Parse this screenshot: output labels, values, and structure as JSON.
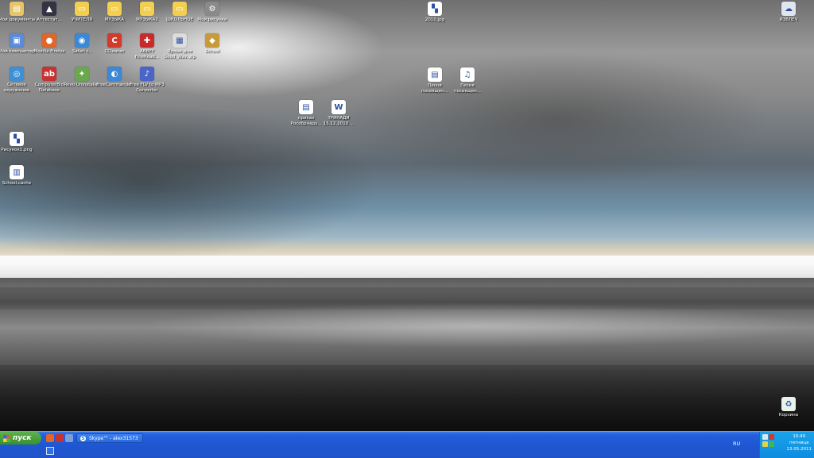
{
  "desktop": {
    "icons": [
      {
        "label": "Мои документы",
        "icon": "documents-folder-icon",
        "color": "#e6c56a",
        "sym": "▤"
      },
      {
        "label": "Аттестат...",
        "icon": "graduation-cap-icon",
        "color": "#333344",
        "sym": "▲"
      },
      {
        "label": "УЧИТЕЛЯ",
        "icon": "folder-icon",
        "color": "#f2cf52",
        "sym": "▭"
      },
      {
        "label": "МУЗЫКА",
        "icon": "folder-icon",
        "color": "#f2cf52",
        "sym": "▭"
      },
      {
        "label": "МУЗЫКА2",
        "icon": "folder-icon",
        "color": "#f2cf52",
        "sym": "▭"
      },
      {
        "label": "ШКОЛЬНОЕ",
        "icon": "folder-icon",
        "color": "#f2cf52",
        "sym": "▭"
      },
      {
        "label": "Мои рисунки",
        "icon": "settings-icon",
        "color": "#8a8a8a",
        "sym": "⚙"
      },
      {
        "label": "Мой компьютер",
        "icon": "computer-icon",
        "color": "#5b8bd9",
        "sym": "▣"
      },
      {
        "label": "Mozilla Firefox",
        "icon": "firefox-icon",
        "color": "#e0662a",
        "sym": "●"
      },
      {
        "label": "Safari с..",
        "icon": "safari-icon",
        "color": "#3b89d6",
        "sym": "◉"
      },
      {
        "label": "CCleaner",
        "icon": "ccleaner-icon",
        "color": "#d23a2a",
        "sym": "C"
      },
      {
        "label": "ABBYY FineRead...",
        "icon": "abbyy-icon",
        "color": "#c92b2b",
        "sym": "✚"
      },
      {
        "label": "Ярлык для Good_Wav..zip",
        "icon": "zip-archive-icon",
        "color": "#dddddd",
        "sym": "▦"
      },
      {
        "label": "School",
        "icon": "school-icon",
        "color": "#c79a3a",
        "sym": "◆"
      },
      {
        "label": "Сетевое окружение",
        "icon": "network-icon",
        "color": "#3d8fd6",
        "sym": "◎"
      },
      {
        "label": "ComputerBld Database",
        "icon": "database-icon",
        "color": "#c83232",
        "sym": "ab"
      },
      {
        "label": "Revo Uninstaller",
        "icon": "uninstaller-icon",
        "color": "#6aa84f",
        "sym": "✦"
      },
      {
        "label": "FreeCommander",
        "icon": "commander-icon",
        "color": "#3b89d6",
        "sym": "◐"
      },
      {
        "label": "Free FLV to MP3 Converter",
        "icon": "converter-icon",
        "color": "#4a64c8",
        "sym": "♪"
      },
      {
        "label": "Рисунок1.png",
        "icon": "image-file-icon",
        "color": "#ffffff",
        "sym": "▚"
      },
      {
        "label": "School.cache",
        "icon": "cache-file-icon",
        "color": "#ffffff",
        "sym": "▥"
      },
      {
        "label": "2010.jpg",
        "icon": "image-file-icon",
        "color": "#ffffff",
        "sym": "▚"
      },
      {
        "label": "Песня посвящен...",
        "icon": "doc-file-icon",
        "color": "#ffffff",
        "sym": "▤"
      },
      {
        "label": "Песня посвящен...",
        "icon": "music-file-icon",
        "color": "#ffffff",
        "sym": "♫"
      },
      {
        "label": "приказ Рособрнадз...",
        "icon": "pdf-file-icon",
        "color": "#ffffff",
        "sym": "▤"
      },
      {
        "label": "ТРИНАДИ 15.12.2010 ...",
        "icon": "word-file-icon",
        "color": "#ffffff",
        "sym": "W"
      },
      {
        "label": "ИЗВЛЕЧ",
        "icon": "cloud-drive-icon",
        "color": "#dfe6ee",
        "sym": "☁"
      },
      {
        "label": "Корзина",
        "icon": "recycle-bin-icon",
        "color": "#e8f2e8",
        "sym": "♻"
      }
    ]
  },
  "taskbar": {
    "start_label": "пуск",
    "window_button": "Skype™ - alex31573",
    "language": "RU",
    "clock": {
      "time": "10:40",
      "day": "пятница",
      "date": "13.05.2011"
    }
  }
}
